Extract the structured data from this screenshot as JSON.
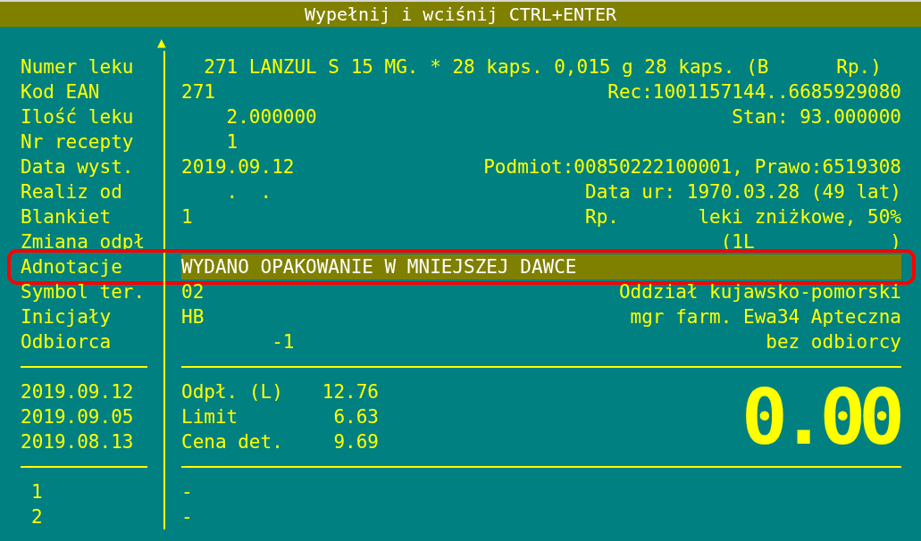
{
  "title": "Wypełnij i wciśnij CTRL+ENTER",
  "scroll_arrow": "▲",
  "fields": [
    {
      "label": "Numer leku",
      "value": "  271 LANZUL S 15 MG. * 28 kaps. 0,015 g 28 kaps. (B      Rp.)",
      "highlighted": false
    },
    {
      "label": "Kod EAN",
      "value": "271",
      "info": "Rec:1001157144..6685929080",
      "highlighted": false
    },
    {
      "label": "Ilość leku",
      "value": "    2.000000",
      "info": "Stan: 93.000000",
      "highlighted": false
    },
    {
      "label": "Nr recepty",
      "value": "    1",
      "highlighted": false
    },
    {
      "label": "Data wyst.",
      "value": "2019.09.12",
      "info": "Podmiot:00850222100001, Prawo:6519308",
      "highlighted": false
    },
    {
      "label": "Realiz od",
      "value": "    .  .",
      "info": "Data ur: 1970.03.28 (49 lat)",
      "highlighted": false
    },
    {
      "label": "Blankiet",
      "value": "1",
      "info": "Rp.       leki zniżkowe, 50%",
      "highlighted": false
    },
    {
      "label": "Zmiana odpł",
      "info": "(1L            )",
      "highlighted": false
    },
    {
      "label": "Adnotacje",
      "value": "WYDANO OPAKOWANIE W MNIEJSZEJ DAWCE",
      "highlighted": true
    },
    {
      "label": "Symbol ter.",
      "value": "02",
      "info": "Oddział kujawsko-pomorski",
      "highlighted": false
    },
    {
      "label": "Inicjały",
      "value": "HB",
      "info": "mgr farm. Ewa34 Apteczna",
      "highlighted": false
    },
    {
      "label": "Odbiorca",
      "value": "        -1",
      "info": "bez odbiorcy",
      "highlighted": false
    }
  ],
  "history_dates": [
    "2019.09.12",
    "2019.09.05",
    "2019.08.13"
  ],
  "summary": [
    {
      "label": "Odpł. (L)",
      "amount": "12.76"
    },
    {
      "label": "Limit",
      "amount": "6.63"
    },
    {
      "label": "Cena det.",
      "amount": "9.69"
    }
  ],
  "total": "0.00",
  "list": [
    {
      "number": "1",
      "text": "-"
    },
    {
      "number": "2",
      "text": "-"
    }
  ]
}
